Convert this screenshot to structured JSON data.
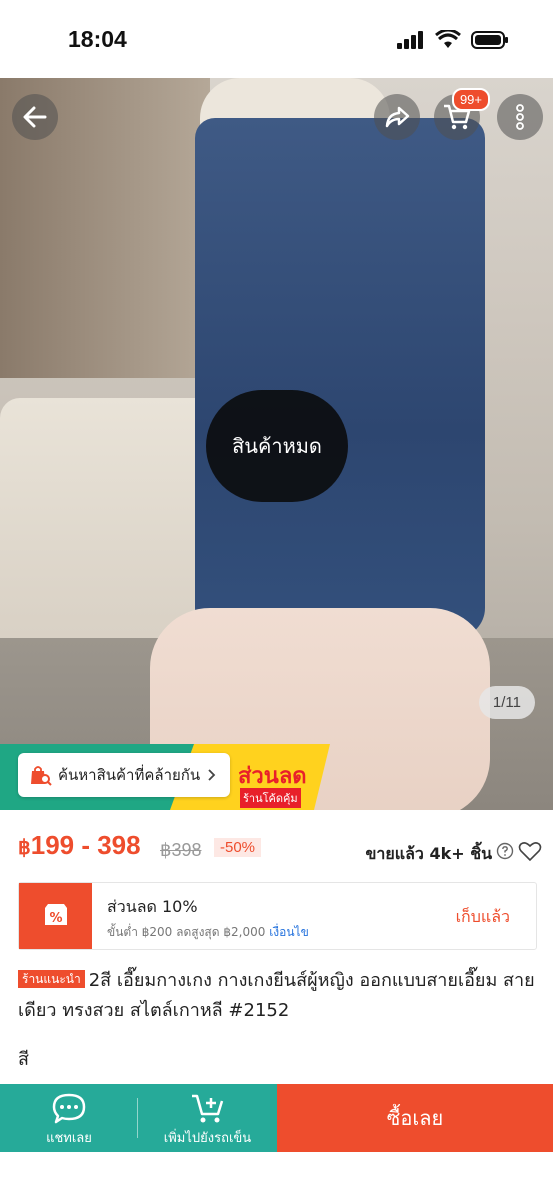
{
  "status": {
    "time": "18:04"
  },
  "hero": {
    "overlay_text": "สินค้าหมด",
    "cart_badge": "99+",
    "counter": "1/11",
    "promo_big": "ส่วนลด",
    "promo_small": "ร้านโค้ดคุ้ม"
  },
  "similar": {
    "label": "ค้นหาสินค้าที่คล้ายกัน"
  },
  "price": {
    "currency": "฿",
    "range": "199 - 398",
    "old": "฿398",
    "discount": "-50%",
    "sold": "ขายแล้ว 4k+ ชิ้น"
  },
  "voucher": {
    "title": "ส่วนลด 10%",
    "condition": "ขั้นต่ำ ฿200 ลดสูงสุด ฿2,000",
    "condition_link": "เงื่อนไข",
    "collect": "เก็บแล้ว"
  },
  "product": {
    "badge": "ร้านแนะนำ",
    "title": "2สี เอี๊ยมกางเกง กางเกงยีนส์ผู้หญิง ออกแบบสายเอี๊ยม สายเดียว ทรงสวย สไตล์เกาหลี #2152"
  },
  "section": {
    "color_label": "สี"
  },
  "bottom_bar": {
    "chat": "แชทเลย",
    "add_cart": "เพิ่มไปยังรถเข็น",
    "buy": "ซื้อเลย"
  },
  "colors": {
    "accent": "#ee4d2d",
    "teal": "#26aa99"
  }
}
